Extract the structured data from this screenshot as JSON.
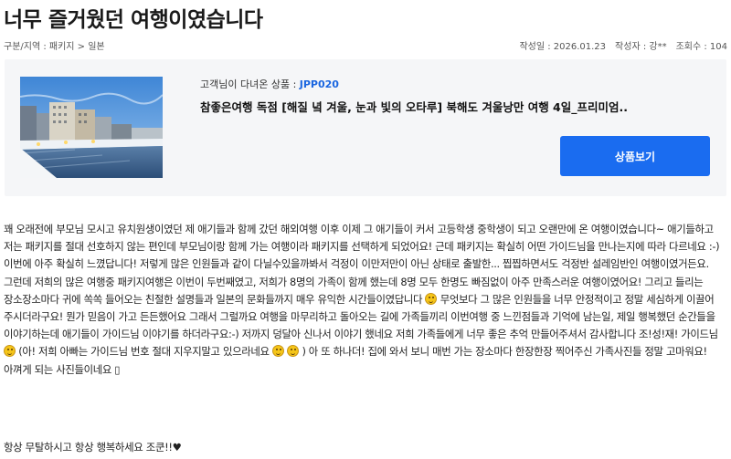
{
  "post": {
    "title": "너무 즐거웠던 여행이였습니다",
    "breadcrumb": "구분/지역 : 패키지 > 일본",
    "date": "작성일 : 2026.01.23",
    "author": "작성자 : 강**",
    "views": "조회수 : 104"
  },
  "product": {
    "label_prefix": "고객님이 다녀온 상품 : ",
    "code": "JPP020",
    "name": "참좋은여행 독점 [해질 녘 겨울, 눈과 빛의 오타루] 북해도 겨울낭만 여행 4일_프리미엄..",
    "view_button": "상품보기"
  },
  "review": {
    "seg1": "꽤 오래전에 부모님 모시고 유치원생이였던 제 애기들과 함께 갔던 해외여행 이후 이제 그 애기들이 커서 고등학생 중학생이 되고 오랜만에 온 여행이였습니다~ 애기들하고 저는 패키지를 절대 선호하지 않는 편인데 부모님이랑 함께 가는 여행이라 패키지를 선택하게 되었어요! 근데 패키지는 확실히 어떤 가이드님을 만나는지에 따라 다르네요 :-) 이번에 아주 확실히 느꼈답니다! 저렇게 많은 인원들과 같이 다닐수있을까봐서 걱정이 이만저만이 아닌 상태로 출발한... 찝찝하면서도 걱정반 설레임반인 여행이였거든요. 그런데 저희의 많은 여행중 패키지여행은 이번이 두번째였고, 저희가 8명의 가족이 함께 했는데 8명 모두 한명도 빠짐없이 아주 만족스러운 여행이였어요! 그리고 들리는 장소장소마다 귀에 쏙쏙 들어오는 친절한 설명들과 일본의 문화들까지 매우 유익한 시간들이였답니다",
    "seg2": " 무엇보다 그 많은 인원들을 너무 안정적이고 정말 세심하게 이끌어 주시더라구요! 뭔가 믿음이 가고 든든했어요 그래서 그럴까요 여행을 마무리하고 돌아오는 길에 가족들끼리 이번여행 중 느낀점들과 기억에 남는일, 제일 행복했던 순간들을 이야기하는데 애기들이 가이드님 이야기를 하더라구요:-) 저까지 덩달아 신나서 이야기 했네요 저희 가족들에게 너무 좋은 추억 만들어주셔서 감사합니다 조!성!재! 가이드님 ",
    "seg3": "(아! 저희 아빠는 가이드님 번호 절대 지우지말고 있으라네요",
    "seg4": ") 아 또 하나더! 집에 와서 보니 매번 가는 장소마다 한장한장 찍어주신 가족사진들 정말 고마워요! 아껴게 되는 사진들이네요 ▯",
    "closing": "항상 무탈하시고 항상 행복하세요 조쿤!!♥"
  },
  "icons": [
    "smile-emoji-icon",
    "heart-eyes-emoji-icon",
    "laugh-emoji-icon",
    "grin-emoji-icon"
  ]
}
